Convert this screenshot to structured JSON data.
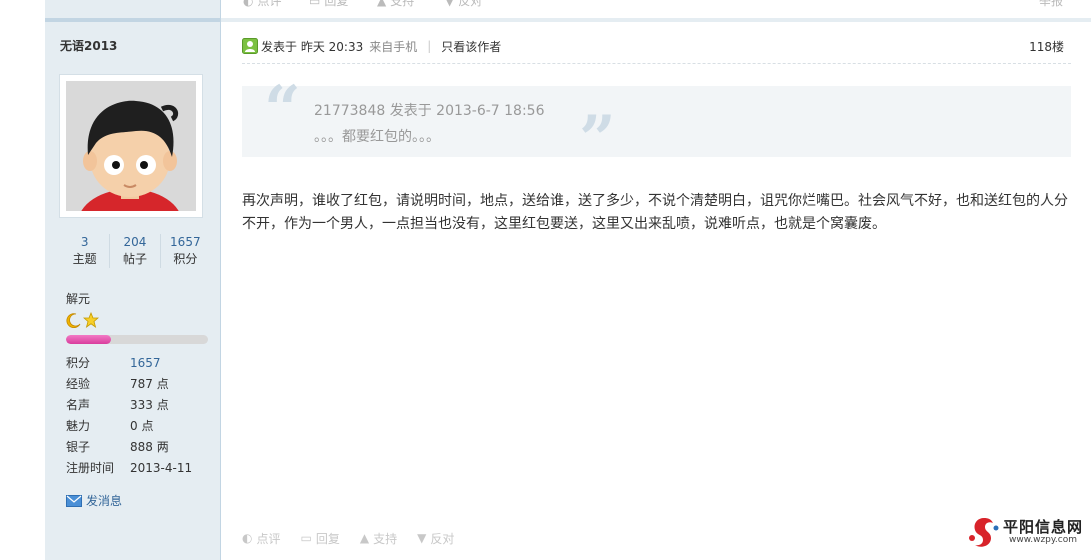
{
  "top_actions": {
    "rate": "点评",
    "reply": "回复",
    "support": "支持",
    "oppose": "反对",
    "report": "举报"
  },
  "author": {
    "name": "无语2013",
    "stats": [
      {
        "num": "3",
        "label": "主题"
      },
      {
        "num": "204",
        "label": "帖子"
      },
      {
        "num": "1657",
        "label": "积分"
      }
    ],
    "rank_title": "解元",
    "rank_progress": 0.32,
    "info": [
      {
        "k": "积分",
        "v": "1657"
      },
      {
        "k": "经验",
        "v": "787 点"
      },
      {
        "k": "名声",
        "v": "333 点"
      },
      {
        "k": "魅力",
        "v": "0 点"
      },
      {
        "k": "银子",
        "v": "888 两"
      },
      {
        "k": "注册时间",
        "v": "2013-4-11"
      }
    ],
    "message": "发消息"
  },
  "post": {
    "posted_prefix": "发表于 昨天 20:33",
    "source": "来自手机",
    "only_author": "只看该作者",
    "floor": "118楼",
    "quote_head": "21773848 发表于 2013-6-7 18:56",
    "quote_body": "。。。都要红包的。。。",
    "content": "再次声明，谁收了红包，请说明时间，地点，送给谁，送了多少，不说个清楚明白，诅咒你烂嘴巴。社会风气不好，也和送红包的人分不开，作为一个男人，一点担当也没有，这里红包要送，这里又出来乱喷，说难听点，也就是个窝囊废。"
  },
  "bottom_actions": {
    "rate": "点评",
    "reply": "回复",
    "support": "支持",
    "oppose": "反对"
  },
  "watermark": {
    "name": "平阳信息网",
    "url": "www.wzpy.com"
  }
}
